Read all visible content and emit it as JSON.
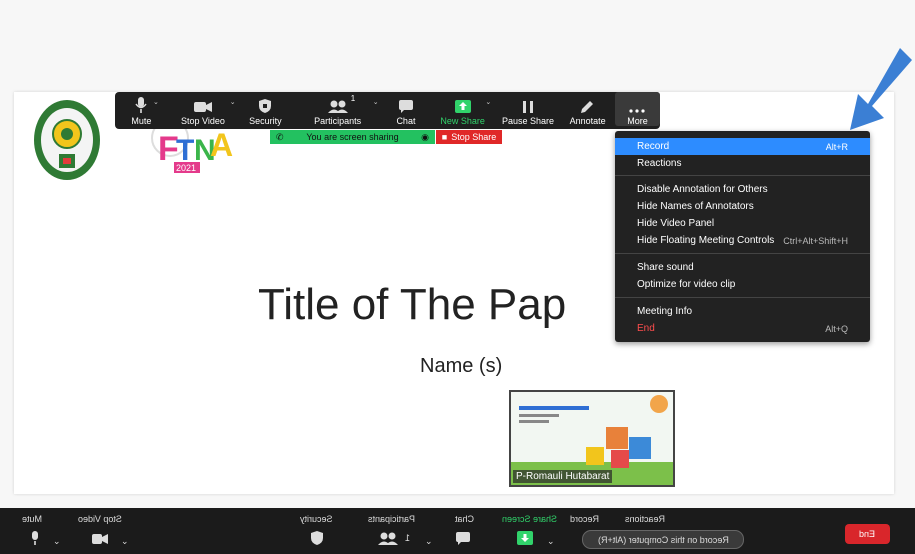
{
  "slide": {
    "title": "Title of The Pap",
    "subtitle": "Name (s)",
    "logo_right_text": "FTNSA",
    "logo_right_year": "2021"
  },
  "video": {
    "participant_name": "P-Romauli Hutabarat"
  },
  "toolbar": {
    "mute": "Mute",
    "stop_video": "Stop Video",
    "security": "Security",
    "participants": "Participants",
    "participants_count": "1",
    "chat": "Chat",
    "new_share": "New Share",
    "pause_share": "Pause Share",
    "annotate": "Annotate",
    "more": "More"
  },
  "share_banner": {
    "text": "You are screen sharing",
    "stop": "Stop Share"
  },
  "more_menu": {
    "items": [
      {
        "label": "Record",
        "shortcut": "Alt+R"
      },
      {
        "label": "Reactions",
        "shortcut": ""
      },
      {
        "label": "Disable Annotation for Others",
        "shortcut": ""
      },
      {
        "label": "Hide Names of Annotators",
        "shortcut": ""
      },
      {
        "label": "Hide Video Panel",
        "shortcut": ""
      },
      {
        "label": "Hide Floating Meeting Controls",
        "shortcut": "Ctrl+Alt+Shift+H"
      },
      {
        "label": "Share sound",
        "shortcut": ""
      },
      {
        "label": "Optimize for video clip",
        "shortcut": ""
      },
      {
        "label": "Meeting Info",
        "shortcut": ""
      },
      {
        "label": "End",
        "shortcut": "Alt+Q"
      }
    ]
  },
  "bottom_bar": {
    "mute": "Mute",
    "stop_video": "Stop Video",
    "security": "Security",
    "participants": "Participants",
    "participants_count": "1",
    "chat": "Chat",
    "share_screen": "Share Screen",
    "record": "Record",
    "reactions": "Reactions",
    "record_tooltip": "Record on this Computer (Alt+R)",
    "end": "End"
  },
  "colors": {
    "accent": "#2d8cff",
    "share_green": "#23c160",
    "stop_red": "#e02828",
    "arrow": "#3b7fd4"
  }
}
